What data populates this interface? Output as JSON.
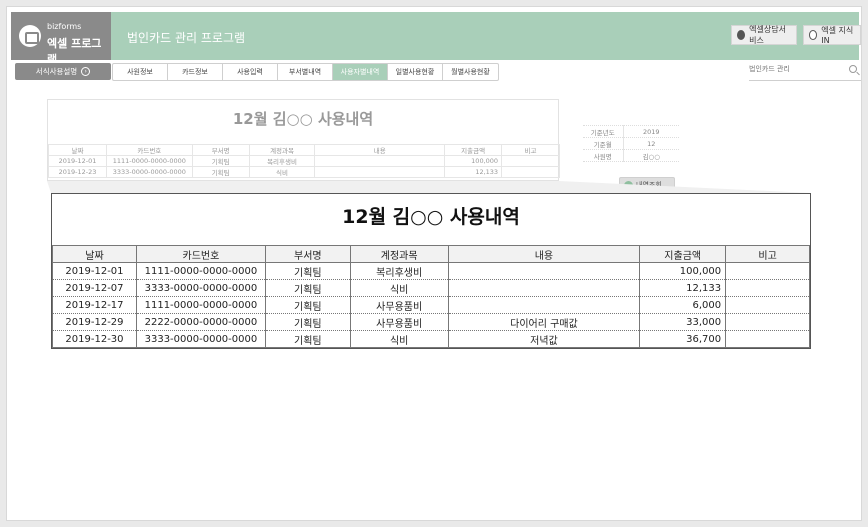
{
  "header": {
    "brand_sub": "bizforms",
    "brand_name": "엑셀 프로그램",
    "app_title": "법인카드 관리 프로그램",
    "btn_consult": "엑셀상담서비스",
    "btn_knowledge": "엑셀 지식 IN"
  },
  "nav": {
    "guide_label": "서식사용설명",
    "tabs": [
      "사원정보",
      "카드정보",
      "사용입력",
      "부서별내역",
      "사용자별내역",
      "일별사용현황",
      "월별사용현황"
    ],
    "active_tab": "사용자별내역",
    "search_placeholder": "법인카드 관리"
  },
  "sheet": {
    "title": "12월 김○○ 사용내역",
    "columns": [
      "날짜",
      "카드번호",
      "부서명",
      "계정과목",
      "내용",
      "지출금액",
      "비고"
    ],
    "rows": [
      [
        "2019-12-01",
        "1111-0000-0000-0000",
        "기획팀",
        "복리후생비",
        "",
        "100,000",
        ""
      ],
      [
        "2019-12-23",
        "3333-0000-0000-0000",
        "기획팀",
        "식비",
        "",
        "12,133",
        ""
      ]
    ]
  },
  "info": {
    "year_label": "기준년도",
    "year": "2019",
    "month_label": "기준월",
    "month": "12",
    "employee_label": "사원명",
    "employee": "김○○"
  },
  "lookup_button": "내역조회",
  "zoom": {
    "title": "12월 김○○ 사용내역",
    "columns": [
      "날짜",
      "카드번호",
      "부서명",
      "계정과목",
      "내용",
      "지출금액",
      "비고"
    ],
    "rows": [
      [
        "2019-12-01",
        "1111-0000-0000-0000",
        "기획팀",
        "복리후생비",
        "",
        "100,000",
        ""
      ],
      [
        "2019-12-07",
        "3333-0000-0000-0000",
        "기획팀",
        "식비",
        "",
        "12,133",
        ""
      ],
      [
        "2019-12-17",
        "1111-0000-0000-0000",
        "기획팀",
        "사무용품비",
        "",
        "6,000",
        ""
      ],
      [
        "2019-12-29",
        "2222-0000-0000-0000",
        "기획팀",
        "사무용품비",
        "다이어리 구매값",
        "33,000",
        ""
      ],
      [
        "2019-12-30",
        "3333-0000-0000-0000",
        "기획팀",
        "식비",
        "저녁값",
        "36,700",
        ""
      ]
    ]
  },
  "colors": {
    "accent": "#a9cfb9",
    "brand_gray": "#8a8a8a"
  }
}
